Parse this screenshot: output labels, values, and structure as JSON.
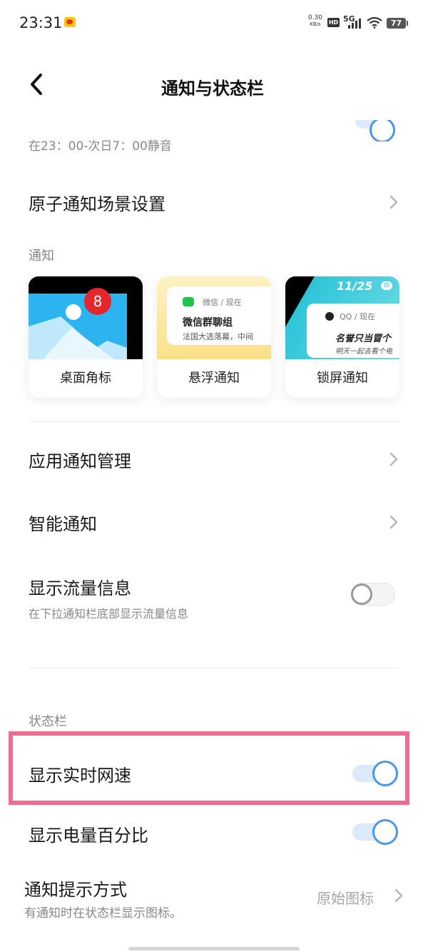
{
  "status_bar": {
    "time": "23:31",
    "net_speed_value": "0.30",
    "net_speed_unit": "KB/s",
    "hd": "HD",
    "network": "5G",
    "battery": "77"
  },
  "header": {
    "title": "通知与状态栏"
  },
  "dnd": {
    "subtitle": "在23：00-次日7：00静音"
  },
  "atomic": {
    "label": "原子通知场景设置"
  },
  "notify_section": {
    "label": "通知"
  },
  "cards": [
    {
      "caption": "桌面角标",
      "badge": "8"
    },
    {
      "caption": "悬浮通知",
      "app": "微信 / 现在",
      "msg_title": "微信群聊组",
      "msg_body": "法国大选落幕，中间"
    },
    {
      "caption": "锁屏通知",
      "date": "11/25",
      "weekday": "四",
      "app": "QQ / 现在",
      "msg_title": "名誉只当冒个",
      "msg_body": "明天一起去看个电"
    }
  ],
  "rows": {
    "app_notify": "应用通知管理",
    "smart_notify": "智能通知",
    "traffic": {
      "title": "显示流量信息",
      "subtitle": "在下拉通知栏底部显示流量信息",
      "enabled": false
    }
  },
  "statusbar_section": {
    "label": "状态栏"
  },
  "realtime_speed": {
    "title": "显示实时网速",
    "enabled": true
  },
  "battery_percent": {
    "title": "显示电量百分比",
    "enabled": true
  },
  "notify_style": {
    "title": "通知提示方式",
    "subtitle": "有通知时在状态栏显示图标。",
    "value": "原始图标"
  },
  "colors": {
    "accent": "#4a96ee",
    "highlight": "#f06b91"
  }
}
